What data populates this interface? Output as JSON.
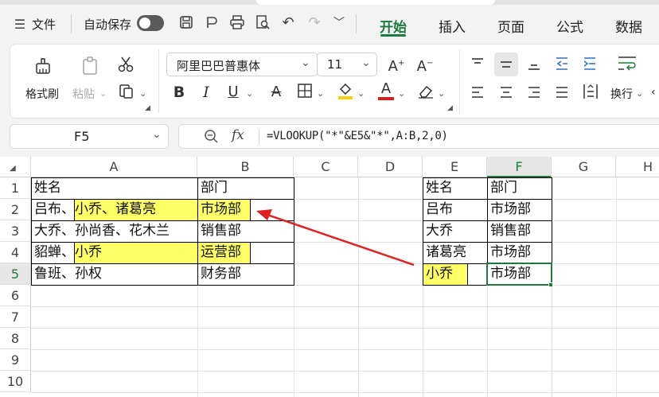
{
  "toolbar": {
    "menu_label": "文件",
    "autosave_label": "自动保存",
    "tabs": [
      "开始",
      "插入",
      "页面",
      "公式",
      "数据"
    ]
  },
  "ribbon": {
    "format_painter": "格式刷",
    "paste": "粘贴",
    "font_name": "阿里巴巴普惠体",
    "font_size": "11",
    "wrap_text": "换行"
  },
  "formula_bar": {
    "name_box": "F5",
    "fx": "fx",
    "formula": "=VLOOKUP(\"*\"&E5&\"*\",A:B,2,0)"
  },
  "sheet": {
    "columns": [
      "A",
      "B",
      "C",
      "D",
      "E",
      "F",
      "G",
      "H"
    ],
    "rows": [
      "1",
      "2",
      "3",
      "4",
      "5",
      "6",
      "7",
      "8",
      "9",
      "10"
    ],
    "left_table": [
      [
        "姓名",
        "部门"
      ],
      [
        "吕布、小乔、诸葛亮",
        "市场部"
      ],
      [
        "大乔、孙尚香、花木兰",
        "销售部"
      ],
      [
        "貂蝉、小乔",
        "运营部"
      ],
      [
        "鲁班、孙权",
        "财务部"
      ]
    ],
    "right_table": [
      [
        "姓名",
        "部门"
      ],
      [
        "吕布",
        "市场部"
      ],
      [
        "大乔",
        "销售部"
      ],
      [
        "诸葛亮",
        "市场部"
      ],
      [
        "小乔",
        "市场部"
      ]
    ]
  },
  "colors": {
    "accent": "#1c7a3c",
    "highlight": "#ffff66",
    "arrow": "#e02020"
  }
}
